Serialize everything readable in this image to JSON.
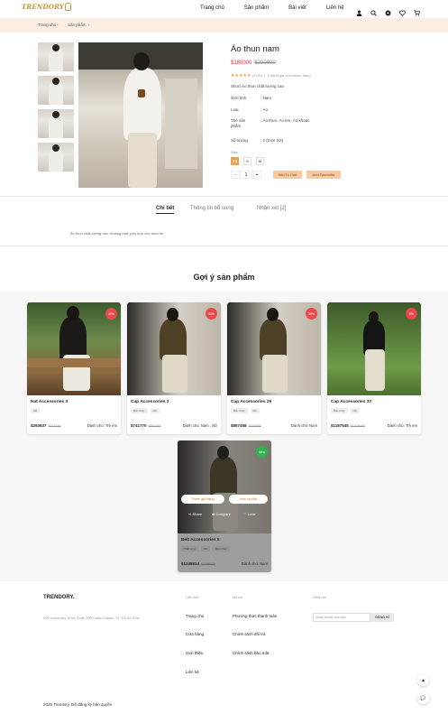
{
  "brand": {
    "logo": "TRENDORY",
    "name": "TRENDORY."
  },
  "nav": [
    "Trang chủ",
    "Sản phẩm",
    "Bài viết",
    "Liên hệ"
  ],
  "header_icons": [
    "user-icon",
    "search-icon",
    "globe-icon",
    "heart-icon",
    "cart-icon"
  ],
  "breadcrumb": [
    "Trang chủ",
    "Sản phẩm"
  ],
  "product": {
    "title": "Áo thun nam",
    "price": "$180000",
    "old_price": "$200000",
    "stars": "★★★★★",
    "rating_text": "(4.5/5)",
    "reviews": "2 đánh giá của khách hàng",
    "short_desc": "Short Áo thun chất lượng cao",
    "specs": [
      {
        "k": "Giới tính",
        "v": "Nam"
      },
      {
        "k": "Loại",
        "v": "Áo"
      },
      {
        "k": "Thẻ sản phẩm",
        "v": "Áo thun, Áo len, Áo khoác"
      },
      {
        "k": "Số lượng",
        "v": "2 (Size XS)"
      }
    ],
    "size_label": "Size",
    "sizes": [
      "XS",
      "S",
      "M"
    ],
    "selected_size": "XS",
    "qty": "1",
    "add_cart": "Add To Cart",
    "add_fav": "Add Favourite"
  },
  "tabs": {
    "items": [
      "Chi tiết",
      "Thông tin bổ sung",
      "Nhận xét [2]"
    ],
    "active": "Chi tiết"
  },
  "tab_content": "Áo thun chất lượng cao, thoáng mát, phù hợp cho mùa hè",
  "suggest_title": "Gợi ý sản phẩm",
  "cards": [
    {
      "name": "Hat Accessories 3",
      "tags": [
        "Mũ"
      ],
      "price": "$293637",
      "old": "$323189",
      "badge": "40%",
      "for": "Dành cho: Trẻ em"
    },
    {
      "name": "Cap Accessories 2",
      "tags": [
        "Bán chạy",
        "Mũ"
      ],
      "price": "$741770",
      "old": "$882248",
      "badge": "30%",
      "for": "Dành cho: Nam , Nữ"
    },
    {
      "name": "Cap Accessories 29",
      "tags": [
        "Bán chạy",
        "Mũ"
      ],
      "price": "$857458",
      "old": "$976595",
      "badge": "30%",
      "for": "Dành cho: Nam"
    },
    {
      "name": "Cap Accessories 37",
      "tags": [
        "Bán chạy",
        "Mũ"
      ],
      "price": "$1187545",
      "old": "$1328088",
      "badge": "5%",
      "for": "Dành cho: Trẻ em"
    },
    {
      "name": "Belt Accessories 5",
      "tags": [
        "Thắt lưng",
        "Mũ",
        "Bán chạy"
      ],
      "price": "$1248814",
      "old": "$1358175",
      "badge": "New",
      "for": "Dành cho: Nam",
      "overlay": {
        "add": "Thêm giỏ hàng",
        "view": "Xem chi tiết",
        "share": "Share",
        "compare": "Compare",
        "love": "Love"
      }
    }
  ],
  "footer": {
    "address": "400 University Drive Suite 200 Coral Gables, FL 33134 USA",
    "col1_title": "Liên kết",
    "col1": [
      "Trang chủ",
      "Cửa hàng",
      "Giới thiệu",
      "Liên hệ"
    ],
    "col2_title": "Hỗ trợ",
    "col2": [
      "Phương thức thanh toán",
      "Chính sách đổi trả",
      "Chính sách bảo mật"
    ],
    "col3_title": "Nhận tin",
    "newsletter_placeholder": "Nhập email của bạn",
    "newsletter_button": "ĐĂNG KÍ",
    "copyright": "2025 Trendory. Đã đăng ký bản quyền"
  },
  "colors": {
    "accent": "#e8a35a",
    "sale": "#e0303b",
    "banner": "#fbeee2"
  }
}
